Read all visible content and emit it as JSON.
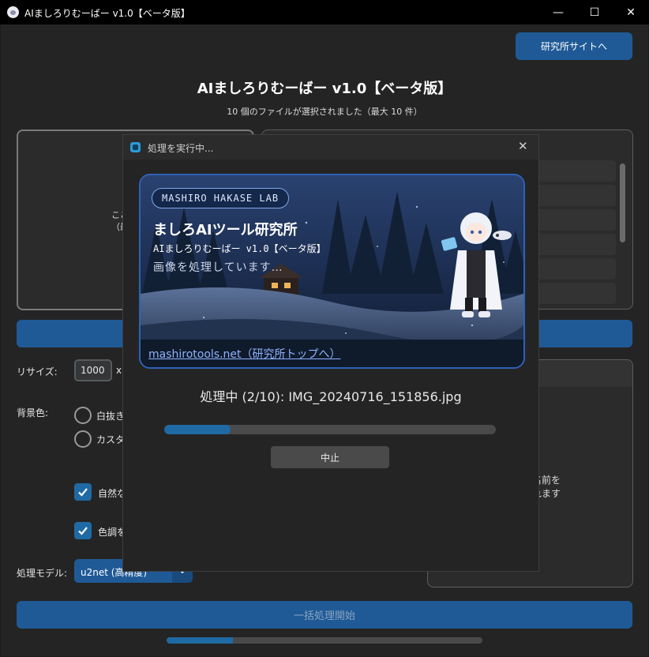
{
  "window": {
    "title": "AIましろりむーばー v1.0【ベータ版】",
    "minimize_glyph": "—",
    "maximize_glyph": "☐",
    "close_glyph": "✕"
  },
  "header": {
    "site_button": "研究所サイトへ",
    "app_title": "AIましろりむーばー v1.0【ベータ版】",
    "file_status": "10 個のファイルが選択されました（最大 10 件）"
  },
  "dropzone": {
    "line1_partial": "ここ",
    "line2_partial": "（最"
  },
  "preview": {
    "text_line1_partial": "覧で名前を",
    "text_line2_partial": "示されます"
  },
  "settings": {
    "resize_label": "リサイズ:",
    "resize_value": "1000",
    "resize_x": "x",
    "bg_label": "背景色:",
    "bg_option_transparent_partial": "白抜き",
    "bg_option_custom_partial": "カスタ",
    "natural_check_partial": "自然な",
    "tone_check_partial": "色調を",
    "natural_checked": true,
    "tone_checked": true,
    "model_label": "処理モデル:",
    "model_value": "u2net (高精度)"
  },
  "footer": {
    "start_button": "一括処理開始",
    "bottom_progress": 0.21
  },
  "dialog": {
    "title": "処理を実行中...",
    "close_glyph": "✕",
    "banner": {
      "pill": "MASHIRO HAKASE LAB",
      "title": "ましろAIツール研究所",
      "subtitle": "AIましろりむーばー v1.0【ベータ版】",
      "status": "画像を処理しています…",
      "link": "mashirotools.net（研究所トップへ）"
    },
    "processing_text": "処理中 (2/10): IMG_20240716_151856.jpg",
    "progress": 0.2,
    "stop_button": "中止"
  },
  "colors": {
    "accent": "#1f5a96",
    "progress": "#1f6aa5",
    "banner_border": "#2f62b8"
  }
}
